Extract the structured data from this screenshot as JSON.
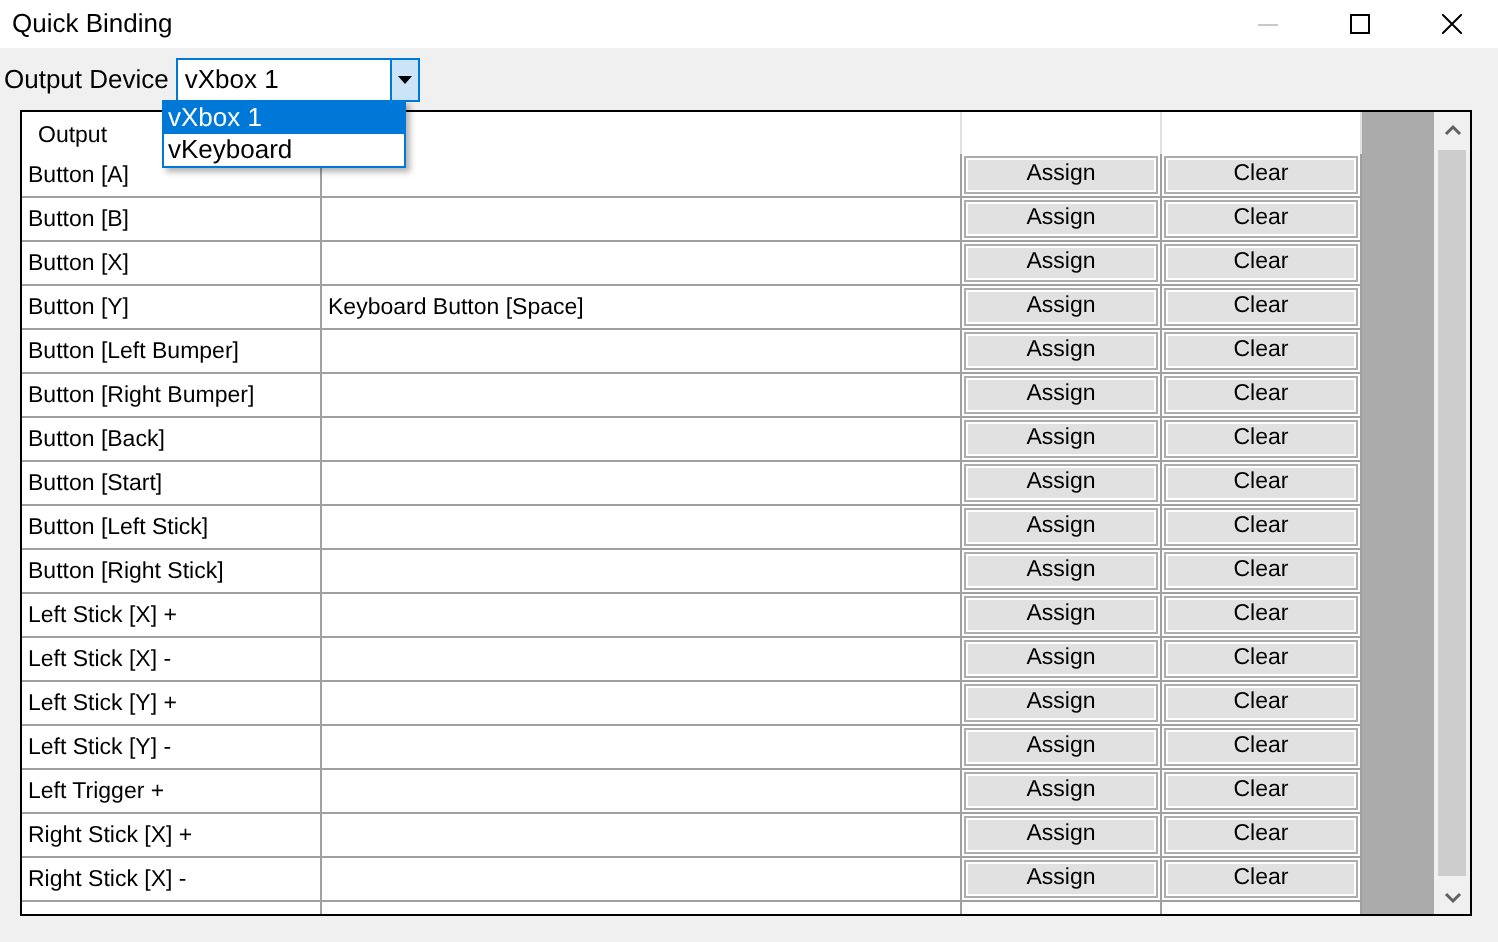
{
  "window": {
    "title": "Quick Binding"
  },
  "output_device": {
    "label": "Output Device",
    "value": "vXbox 1",
    "expanded": true,
    "options": [
      {
        "label": "vXbox 1",
        "selected": true
      },
      {
        "label": "vKeyboard",
        "selected": false
      }
    ]
  },
  "table": {
    "columns": [
      "Output"
    ],
    "rows": [
      {
        "output": "Button [A]",
        "assign": "Assign",
        "clear": "Clear"
      },
      {
        "output": "Button [B]",
        "assign": "Assign",
        "clear": "Clear"
      },
      {
        "output": "Button [X]",
        "assign": "Assign",
        "clear": "Clear"
      },
      {
        "output": "Button [Y]",
        "binding": "Keyboard Button [Space]",
        "assign": "Assign",
        "clear": "Clear"
      },
      {
        "output": "Button [Left Bumper]",
        "assign": "Assign",
        "clear": "Clear"
      },
      {
        "output": "Button [Right Bumper]",
        "assign": "Assign",
        "clear": "Clear"
      },
      {
        "output": "Button [Back]",
        "assign": "Assign",
        "clear": "Clear"
      },
      {
        "output": "Button [Start]",
        "assign": "Assign",
        "clear": "Clear"
      },
      {
        "output": "Button [Left Stick]",
        "assign": "Assign",
        "clear": "Clear"
      },
      {
        "output": "Button [Right Stick]",
        "assign": "Assign",
        "clear": "Clear"
      },
      {
        "output": "Left Stick [X] +",
        "assign": "Assign",
        "clear": "Clear"
      },
      {
        "output": "Left Stick [X] -",
        "assign": "Assign",
        "clear": "Clear"
      },
      {
        "output": "Left Stick [Y] +",
        "assign": "Assign",
        "clear": "Clear"
      },
      {
        "output": "Left Stick [Y] -",
        "assign": "Assign",
        "clear": "Clear"
      },
      {
        "output": "Left Trigger +",
        "assign": "Assign",
        "clear": "Clear"
      },
      {
        "output": "Right Stick [X] +",
        "assign": "Assign",
        "clear": "Clear"
      },
      {
        "output": "Right Stick [X] -",
        "assign": "Assign",
        "clear": "Clear"
      }
    ]
  }
}
